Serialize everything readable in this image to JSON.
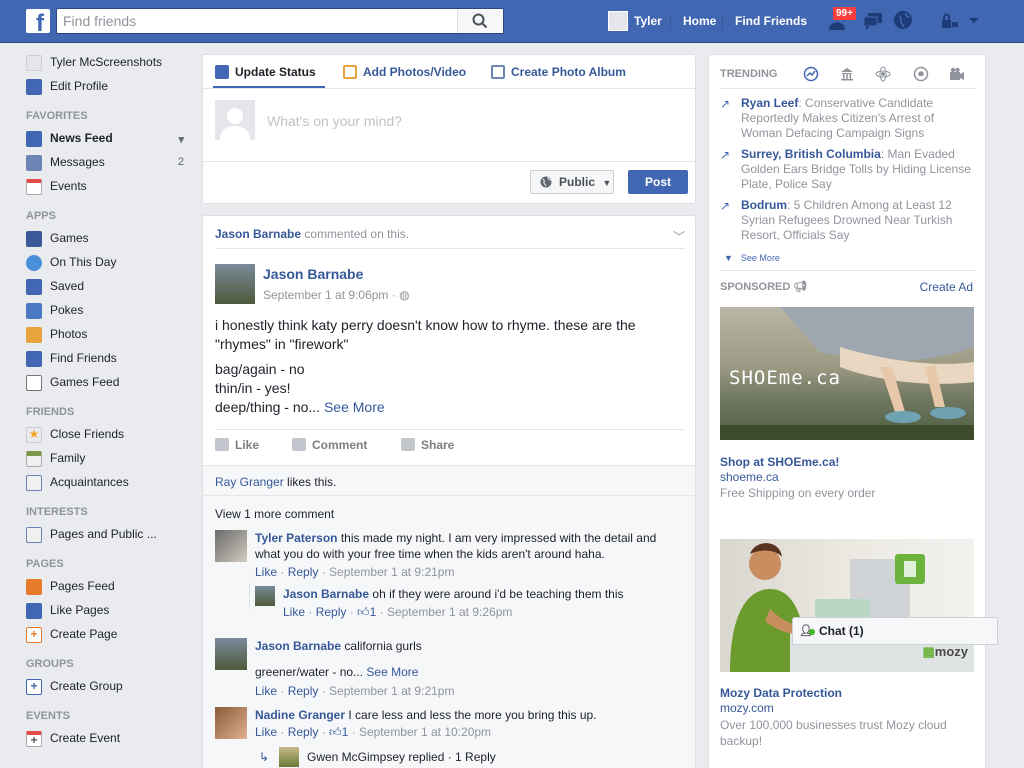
{
  "topbar": {
    "search_placeholder": "Find friends",
    "user_name": "Tyler",
    "home_label": "Home",
    "find_friends_label": "Find Friends",
    "friend_requests_badge": "99+",
    "brand_color": "#4267b2"
  },
  "leftnav": {
    "profile": {
      "name": "Tyler McScreenshots",
      "edit": "Edit Profile"
    },
    "favorites_header": "FAVORITES",
    "favorites": [
      {
        "label": "News Feed",
        "icon": "news-feed-icon"
      },
      {
        "label": "Messages",
        "count": "2",
        "icon": "messages-icon"
      },
      {
        "label": "Events",
        "icon": "events-icon"
      }
    ],
    "apps_header": "APPS",
    "apps": [
      {
        "label": "Games",
        "icon": "games-icon"
      },
      {
        "label": "On This Day",
        "icon": "on-this-day-icon"
      },
      {
        "label": "Saved",
        "icon": "saved-icon"
      },
      {
        "label": "Pokes",
        "icon": "pokes-icon"
      },
      {
        "label": "Photos",
        "icon": "photos-icon"
      },
      {
        "label": "Find Friends",
        "icon": "find-friends-icon"
      },
      {
        "label": "Games Feed",
        "icon": "games-feed-icon"
      }
    ],
    "friends_header": "FRIENDS",
    "friends": [
      {
        "label": "Close Friends",
        "icon": "star-icon"
      },
      {
        "label": "Family",
        "icon": "family-icon"
      },
      {
        "label": "Acquaintances",
        "icon": "acquaintances-icon"
      }
    ],
    "interests_header": "INTERESTS",
    "interests": [
      {
        "label": "Pages and Public ...",
        "icon": "pages-icon"
      }
    ],
    "pages_header": "PAGES",
    "pages": [
      {
        "label": "Pages Feed",
        "icon": "pages-feed-icon"
      },
      {
        "label": "Like Pages",
        "icon": "like-pages-icon"
      },
      {
        "label": "Create Page",
        "icon": "create-page-icon"
      }
    ],
    "groups_header": "GROUPS",
    "groups": [
      {
        "label": "Create Group",
        "icon": "create-group-icon"
      }
    ],
    "events_header": "EVENTS",
    "events": [
      {
        "label": "Create Event",
        "icon": "create-event-icon"
      }
    ]
  },
  "composer": {
    "tab_status": "Update Status",
    "tab_photos": "Add Photos/Video",
    "tab_album": "Create Photo Album",
    "placeholder": "What's on your mind?",
    "audience": "Public",
    "post_button": "Post"
  },
  "story": {
    "header_name": "Jason Barnabe",
    "header_action": "commented on this.",
    "author": "Jason Barnabe",
    "time": "September 1 at 9:06pm",
    "text_line1": "i honestly think katy perry doesn't know how to rhyme. these are the \"rhymes\" in \"firework\"",
    "text_line2": "bag/again - no",
    "text_line3": "thin/in - yes!",
    "text_line4": "deep/thing - no...",
    "see_more": "See More",
    "like": "Like",
    "comment": "Comment",
    "share": "Share",
    "likes_name": "Ray Granger",
    "likes_text": "likes this.",
    "view_more": "View 1 more comment",
    "comments": [
      {
        "name": "Tyler Paterson",
        "text": "this made my night. I am very impressed with the detail and what you do with your free time when the kids aren't around haha.",
        "like": "Like",
        "reply": "Reply",
        "time": "September 1 at 9:21pm"
      },
      {
        "name": "Jason Barnabe",
        "text": "oh if they were around i'd be teaching them this",
        "like": "Like",
        "reply": "Reply",
        "likes": "1",
        "time": "September 1 at 9:26pm"
      },
      {
        "name": "Jason Barnabe",
        "text": "california gurls",
        "text2": "greener/water - no...",
        "see_more": "See More",
        "like": "Like",
        "reply": "Reply",
        "time": "September 1 at 9:21pm"
      },
      {
        "name": "Nadine Granger",
        "text": "I care less and less the more you bring this up.",
        "like": "Like",
        "reply": "Reply",
        "likes": "1",
        "time": "September 1 at 10:20pm"
      }
    ],
    "reply_summary": "Gwen McGimpsey replied · 1 Reply"
  },
  "trending": {
    "header": "TRENDING",
    "items": [
      {
        "name": "Ryan Leef",
        "text": "Conservative Candidate Reportedly Makes Citizen's Arrest of Woman Defacing Campaign Signs"
      },
      {
        "name": "Surrey, British Columbia",
        "text": "Man Evaded Golden Ears Bridge Tolls by Hiding License Plate, Police Say"
      },
      {
        "name": "Bodrum",
        "text": "5 Children Among at Least 12 Syrian Refugees Drowned Near Turkish Resort, Officials Say"
      }
    ],
    "see_more": "See More"
  },
  "sponsored": {
    "header": "SPONSORED",
    "create_ad": "Create Ad",
    "ads": [
      {
        "image_text": "SHOEme.ca",
        "title": "Shop at SHOEme.ca!",
        "url": "shoeme.ca",
        "desc": "Free Shipping on every order"
      },
      {
        "image_text": "mozy",
        "title": "Mozy Data Protection",
        "url": "mozy.com",
        "desc": "Over 100,000 businesses trust Mozy cloud backup!"
      }
    ]
  },
  "chat": {
    "label": "Chat (1)"
  }
}
